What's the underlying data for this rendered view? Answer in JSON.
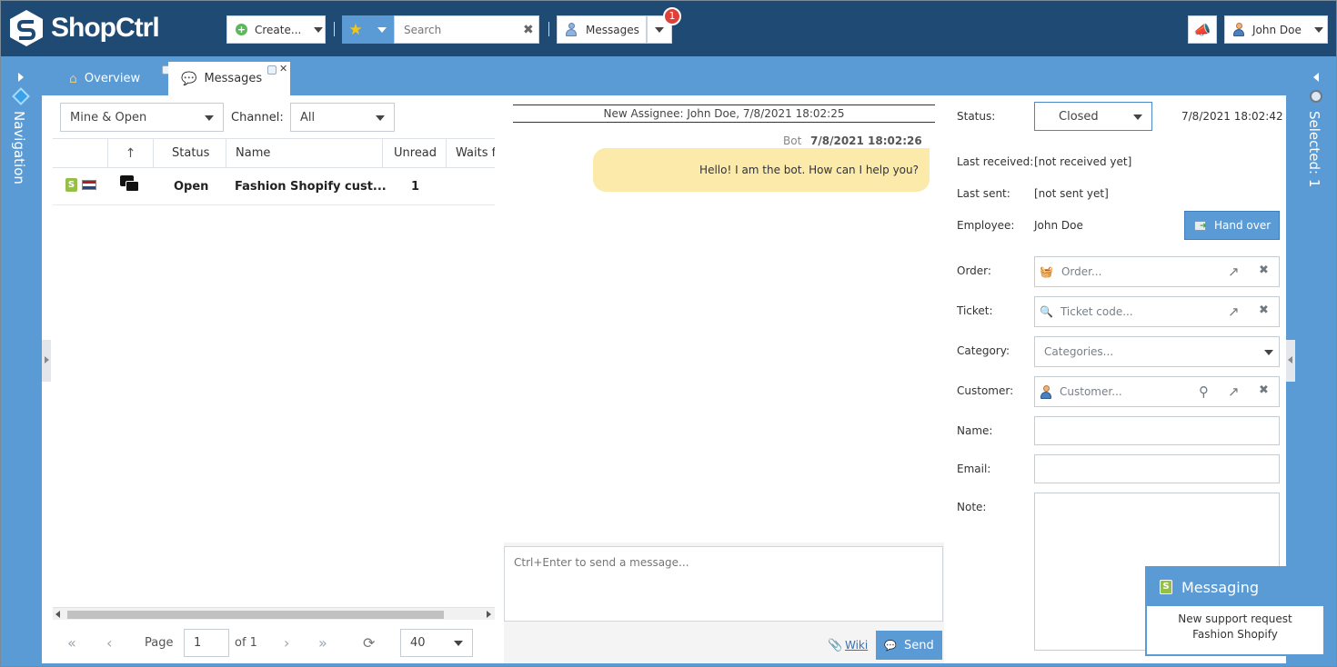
{
  "app": {
    "name": "ShopCtrl"
  },
  "topbar": {
    "create_label": "Create...",
    "search_placeholder": "Search",
    "messages_label": "Messages",
    "messages_badge": "1",
    "user_name": "John Doe"
  },
  "rails": {
    "left_label": "Navigation",
    "right_label": "Selected: 1"
  },
  "tabs": [
    {
      "label": "Overview"
    },
    {
      "label": "Messages"
    }
  ],
  "filters": {
    "scope_value": "Mine & Open",
    "channel_label": "Channel:",
    "channel_value": "All"
  },
  "grid": {
    "columns": [
      "Status",
      "Name",
      "Unread",
      "Waits fo"
    ],
    "rows": [
      {
        "status": "Open",
        "name": "Fashion Shopify cust...",
        "unread": "1"
      }
    ]
  },
  "pager": {
    "page_label": "Page",
    "page_value": "1",
    "of_label": "of 1",
    "page_size": "40"
  },
  "chat": {
    "system_line": "New Assignee: John Doe, 7/8/2021 18:02:25",
    "messages": [
      {
        "sender": "Bot",
        "time": "7/8/2021 18:02:26",
        "text": "Hello! I am the bot. How can I help you?"
      }
    ],
    "composer_placeholder": "Ctrl+Enter to send a message...",
    "wiki_label": "Wiki",
    "send_label": "Send"
  },
  "details": {
    "status_label": "Status:",
    "status_value": "Closed",
    "status_time": "7/8/2021 18:02:42",
    "last_received_label": "Last received:",
    "last_received_value": "[not received yet]",
    "last_sent_label": "Last sent:",
    "last_sent_value": "[not sent yet]",
    "employee_label": "Employee:",
    "employee_value": "John Doe",
    "hand_over_label": "Hand over",
    "order_label": "Order:",
    "order_placeholder": "Order...",
    "ticket_label": "Ticket:",
    "ticket_placeholder": "Ticket code...",
    "category_label": "Category:",
    "category_placeholder": "Categories...",
    "customer_label": "Customer:",
    "customer_placeholder": "Customer...",
    "name_label": "Name:",
    "email_label": "Email:",
    "note_label": "Note:"
  },
  "toast": {
    "title": "Messaging",
    "line1": "New support request",
    "line2": "Fashion Shopify"
  },
  "colors": {
    "topbar": "#1f4a73",
    "accent": "#5b9bd5",
    "bubble": "#fbeaa9",
    "badge": "#e0403a"
  }
}
